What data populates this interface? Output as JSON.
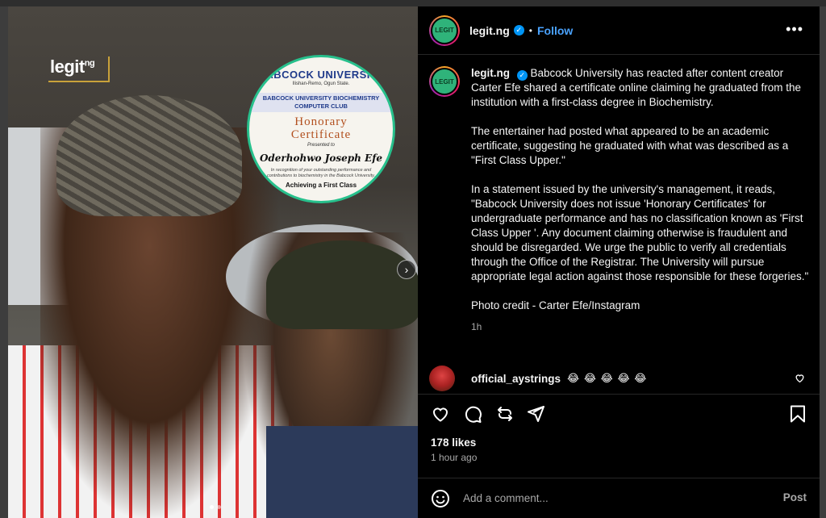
{
  "media": {
    "watermark_logo": "legit",
    "watermark_suffix": "ng",
    "certificate": {
      "university": "BABCOCK UNIVERSITY",
      "address": "Ilishan-Remo, Ogun State.",
      "club_line1": "BABCOCK UNIVERSITY BIOCHEMISTRY",
      "club_line2": "COMPUTER CLUB",
      "title_line1": "Honorary",
      "title_line2": "Certificate",
      "presented": "Presented to",
      "recipient": "Oderhohwo Joseph Efe",
      "reason": "In recognition of your outstanding performance and contributions to biochemistry in the Babcock University.",
      "footer": "Achieving a First Class"
    },
    "next_glyph": "›"
  },
  "header": {
    "avatar_text": "LEGIT",
    "username": "legit.ng",
    "verified_glyph": "✓",
    "separator": "•",
    "follow_label": "Follow",
    "more_glyph": "•••"
  },
  "caption": {
    "username": "legit.ng",
    "verified_glyph": "✓",
    "para1": "Babcock University has reacted after content creator Carter Efe shared a certificate online claiming he graduated from the institution with a first-class degree in Biochemistry.",
    "para2": "The entertainer had posted what appeared to be an academic certificate, suggesting he graduated with what was described as a \"First Class Upper.\"",
    "para3": "In a statement issued by the university's management, it reads, \"Babcock University does not issue 'Honorary Certificates' for undergraduate performance and has no classification known as 'First Class Upper '. Any document claiming otherwise is fraudulent and should be disregarded. We urge the public to verify all credentials through the Office of the Registrar. The University will pursue appropriate legal action against those responsible for these forgeries.\"",
    "para4": "Photo credit - Carter Efe/Instagram",
    "time": "1h"
  },
  "comment": {
    "username": "official_aystrings",
    "body": "😂 😂 😂 😂 😂"
  },
  "actions": {
    "icons": [
      "heart-icon",
      "comment-icon",
      "share-icon",
      "send-icon",
      "bookmark-icon"
    ]
  },
  "likes": "178 likes",
  "posted": "1 hour ago",
  "add_comment": {
    "placeholder": "Add a comment...",
    "post_label": "Post"
  },
  "colors": {
    "panel_bg": "#000000",
    "accent_blue": "#4aa3ff",
    "verified_blue": "#0095f6",
    "muted": "#a8a8a8"
  }
}
